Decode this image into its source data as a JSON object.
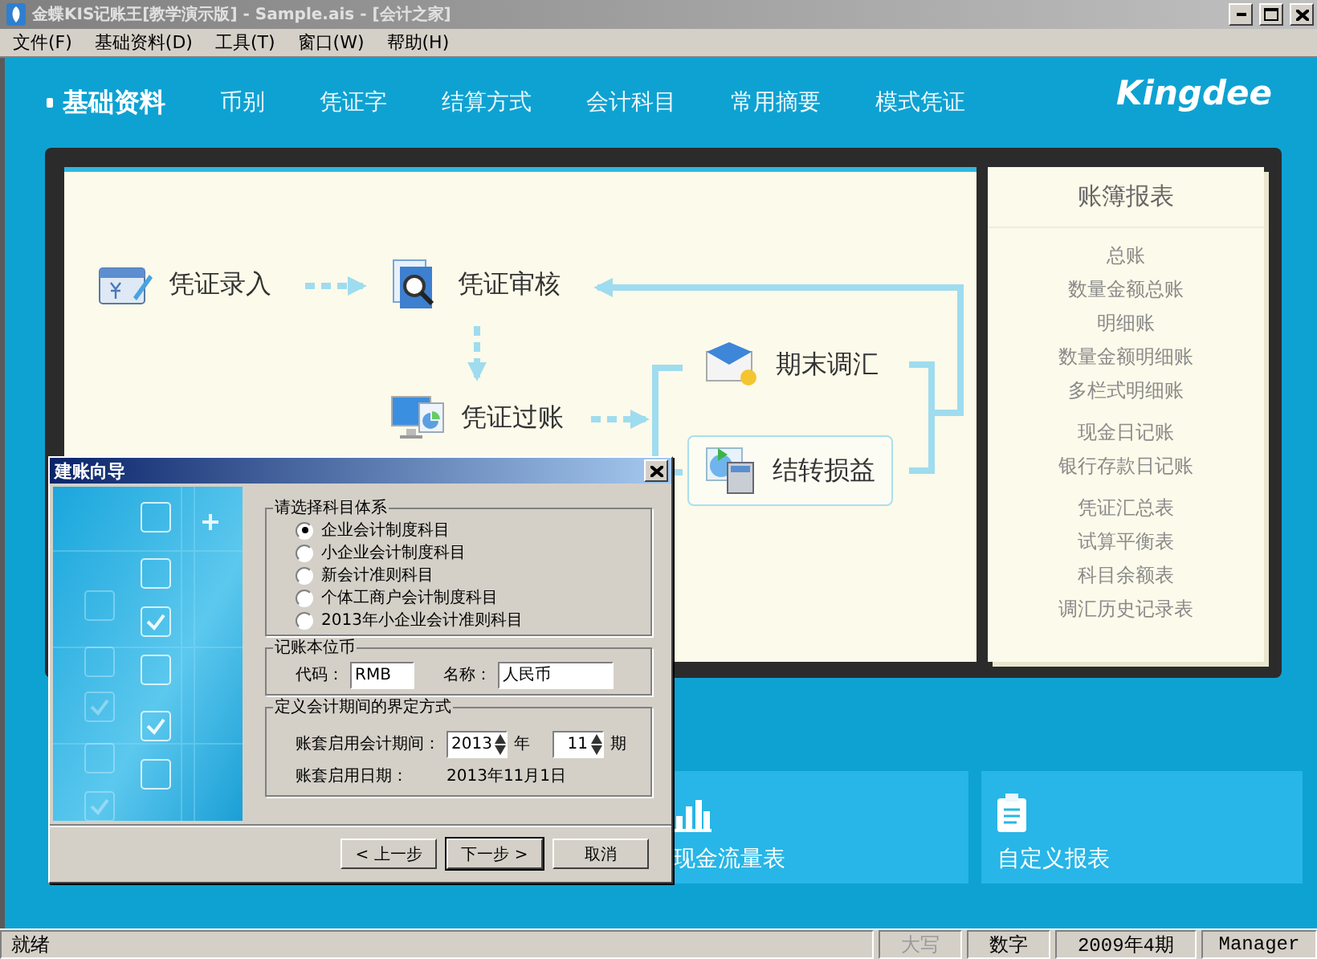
{
  "window": {
    "title": "金蝶KIS记账王[教学演示版] - Sample.ais - [会计之家]"
  },
  "menu": [
    "文件(F)",
    "基础资料(D)",
    "工具(T)",
    "窗口(W)",
    "帮助(H)"
  ],
  "nav": {
    "items": [
      {
        "label": "基础资料",
        "selected": true
      },
      {
        "label": "币别",
        "selected": false
      },
      {
        "label": "凭证字",
        "selected": false
      },
      {
        "label": "结算方式",
        "selected": false
      },
      {
        "label": "会计科目",
        "selected": false
      },
      {
        "label": "常用摘要",
        "selected": false
      },
      {
        "label": "模式凭证",
        "selected": false
      }
    ],
    "logo": "Kingdee"
  },
  "flow": {
    "nodes": [
      {
        "label": "凭证录入",
        "kind": "entry",
        "highlighted": false
      },
      {
        "label": "凭证审核",
        "kind": "audit",
        "highlighted": false
      },
      {
        "label": "凭证过账",
        "kind": "posting",
        "highlighted": false
      },
      {
        "label": "期末调汇",
        "kind": "exchange",
        "highlighted": false
      },
      {
        "label": "结转损益",
        "kind": "transfer",
        "highlighted": true
      }
    ]
  },
  "reports": {
    "title": "账簿报表",
    "groups": [
      [
        "总账",
        "数量金额总账",
        "明细账",
        "数量金额明细账",
        "多栏式明细账"
      ],
      [
        "现金日记账",
        "银行存款日记账"
      ],
      [
        "凭证汇总表",
        "试算平衡表",
        "科目余额表",
        "调汇历史记录表"
      ]
    ]
  },
  "tiles": [
    {
      "label": "现金流量表",
      "kind": "chart"
    },
    {
      "label": "自定义报表",
      "kind": "clipboard"
    }
  ],
  "dialog": {
    "title": "建账向导",
    "subject_system": {
      "legend": "请选择科目体系",
      "options": [
        {
          "label": "企业会计制度科目",
          "selected": true
        },
        {
          "label": "小企业会计制度科目",
          "selected": false
        },
        {
          "label": "新会计准则科目",
          "selected": false
        },
        {
          "label": "个体工商户会计制度科目",
          "selected": false
        },
        {
          "label": "2013年小企业会计准则科目",
          "selected": false
        }
      ]
    },
    "currency": {
      "legend": "记账本位币",
      "code_label": "代码：",
      "code": "RMB",
      "name_label": "名称：",
      "name": "人民币"
    },
    "period": {
      "legend": "定义会计期间的界定方式",
      "start_label": "账套启用会计期间：",
      "year": "2013",
      "year_unit": "年",
      "period": "11",
      "period_unit": "期",
      "date_label": "账套启用日期：",
      "date": "2013年11月1日"
    },
    "buttons": [
      {
        "label": "< 上一步",
        "focused": false
      },
      {
        "label": "下一步 >",
        "focused": true
      },
      {
        "label": "取消",
        "focused": false
      }
    ]
  },
  "status_bar": [
    {
      "text": "就绪",
      "disabled": false
    },
    {
      "text": "大写",
      "disabled": true
    },
    {
      "text": "数字",
      "disabled": false
    },
    {
      "text": "2009年4期",
      "disabled": false
    },
    {
      "text": "Manager",
      "disabled": false
    }
  ]
}
